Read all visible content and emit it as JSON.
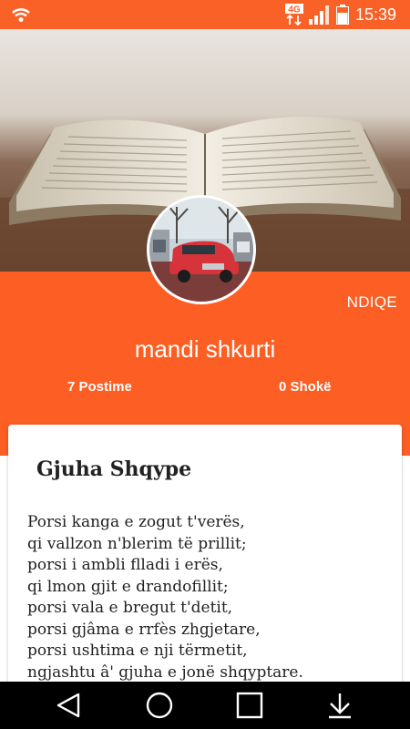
{
  "status_bar": {
    "time": "15:39",
    "network": "4G",
    "icons": [
      "wifi-icon",
      "lte-icon",
      "signal-icon",
      "battery-icon"
    ]
  },
  "profile": {
    "follow_label": "NDIQE",
    "username": "mandi shkurti",
    "posts_label": "7 Postime",
    "friends_label": "0 Shokë"
  },
  "post": {
    "title": "Gjuha Shqype",
    "lines": [
      "Porsi kanga e zogut t'verës,",
      "qi vallzon n'blerim të prillit;",
      "porsi i ambli flladi i erës,",
      "qi lmon gjit e drandofillit;",
      "porsi vala e bregut t'detit,",
      "porsi gjâma e rrfès zhgjetare,",
      "porsi ushtima e nji tërmetit,",
      "ngjashtu â' gjuha e jonë shqyptare."
    ]
  },
  "nav_bar": {
    "buttons": [
      "back-icon",
      "home-icon",
      "recent-apps-icon",
      "notifications-down-icon"
    ]
  },
  "colors": {
    "accent": "#fc5e23",
    "status_bar": "#fa6126",
    "nav_bar": "#000000",
    "card": "#ffffff"
  }
}
